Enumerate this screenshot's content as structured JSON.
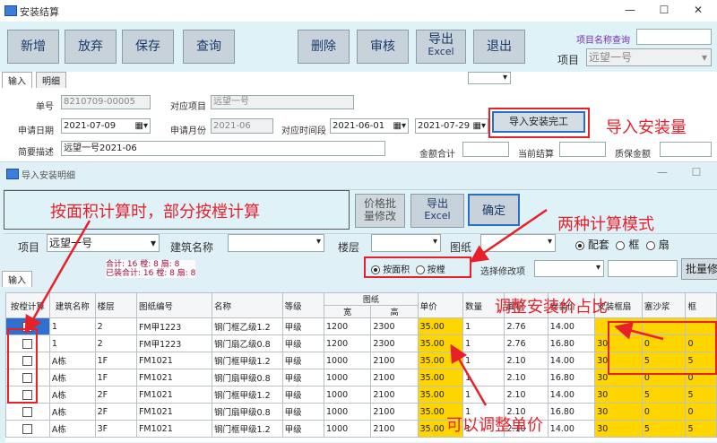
{
  "main_window": {
    "title": "安装结算",
    "toolbar": {
      "add": "新增",
      "discard": "放弃",
      "save": "保存",
      "query": "查询",
      "delete": "删除",
      "review": "审核",
      "export_line1": "导出",
      "export_line2": "Excel",
      "exit": "退出"
    },
    "project_lookup_label": "项目名称查询",
    "project_label": "项目",
    "project_value": "远望一号",
    "tabs": [
      "输入",
      "明细"
    ],
    "fields": {
      "doc_no_label": "单号",
      "doc_no": "8210709-00005",
      "proj_label": "对应项目",
      "proj_value": "远望一号",
      "apply_date_label": "申请日期",
      "apply_date": "2021-07-09",
      "apply_month_label": "申请月份",
      "apply_month": "2021-06",
      "period_label": "对应时间段",
      "period_start": "2021-06-01",
      "period_end": "2021-07-29",
      "import_btn": "导入安装完工",
      "desc_label": "简要描述",
      "desc_value": "远望一号2021-06",
      "total_label": "金额合计",
      "current_label": "当前结算",
      "warranty_label": "质保金额"
    }
  },
  "annotations": {
    "import_qty": "导入安装量",
    "area_calc": "按面积计算时，部分按樘计算",
    "two_modes": "两种计算模式",
    "adjust_ratio": "调整安装价占比",
    "adjust_price": "可以调整单价"
  },
  "detail_window": {
    "title": "导入安装明细",
    "price_btn_line1": "价格批",
    "price_btn_line2": "量修改",
    "export_line1": "导出",
    "export_line2": "Excel",
    "confirm": "确定",
    "filters": {
      "project_label": "项目",
      "project_value": "远望一号",
      "building_label": "建筑名称",
      "floor_label": "楼层",
      "drawing_label": "图纸"
    },
    "mode_options": [
      "配套",
      "框",
      "扇"
    ],
    "mode_selected": "配套",
    "summary_line1": "合计: 16 樘: 8 扇: 8",
    "summary_line2": "已装合计: 16 樘: 8 扇: 8",
    "calc_options": [
      "按面积",
      "按樘"
    ],
    "calc_selected": "按面积",
    "modify_label": "选择修改项",
    "batch_btn": "批量修",
    "table": {
      "headers": [
        "按樘计算",
        "建筑名称",
        "楼层",
        "图纸编号",
        "名称",
        "等级",
        "图纸",
        "单价",
        "数量",
        "面积",
        "安装价",
        "安装框扇",
        "塞沙浆",
        "框"
      ],
      "drawing_sub": [
        "宽",
        "高"
      ],
      "rows": [
        [
          "",
          "1",
          "2",
          "FM甲1223",
          "钢门框乙级1.2",
          "甲级",
          "1200",
          "2300",
          "35.00",
          "1",
          "2.76",
          "14.00",
          "",
          "",
          ""
        ],
        [
          "",
          "1",
          "2",
          "FM甲1223",
          "钢门扇乙级0.8",
          "甲级",
          "1200",
          "2300",
          "35.00",
          "1",
          "2.76",
          "16.80",
          "30",
          "0",
          "0"
        ],
        [
          "",
          "A栋",
          "1F",
          "FM1021",
          "钢门框甲级1.2",
          "甲级",
          "1000",
          "2100",
          "35.00",
          "1",
          "2.10",
          "14.00",
          "30",
          "5",
          "5"
        ],
        [
          "",
          "A栋",
          "1F",
          "FM1021",
          "钢门扇甲级0.8",
          "甲级",
          "1000",
          "2100",
          "35.00",
          "1",
          "2.10",
          "16.80",
          "30",
          "0",
          "0"
        ],
        [
          "",
          "A栋",
          "2F",
          "FM1021",
          "钢门框甲级1.2",
          "甲级",
          "1000",
          "2100",
          "35.00",
          "1",
          "2.10",
          "14.00",
          "30",
          "5",
          "5"
        ],
        [
          "",
          "A栋",
          "2F",
          "FM1021",
          "钢门扇甲级0.8",
          "甲级",
          "1000",
          "2100",
          "35.00",
          "1",
          "2.10",
          "16.80",
          "30",
          "0",
          "0"
        ],
        [
          "",
          "A栋",
          "3F",
          "FM1021",
          "钢门框甲级1.2",
          "甲级",
          "1000",
          "2100",
          "35.00",
          "1",
          "2.10",
          "14.00",
          "30",
          "5",
          "5"
        ]
      ]
    }
  },
  "colors": {
    "accent_red": "#e8202a",
    "highlight_yellow": "#ffd500",
    "toolbar_bg": "#dff2f8"
  }
}
